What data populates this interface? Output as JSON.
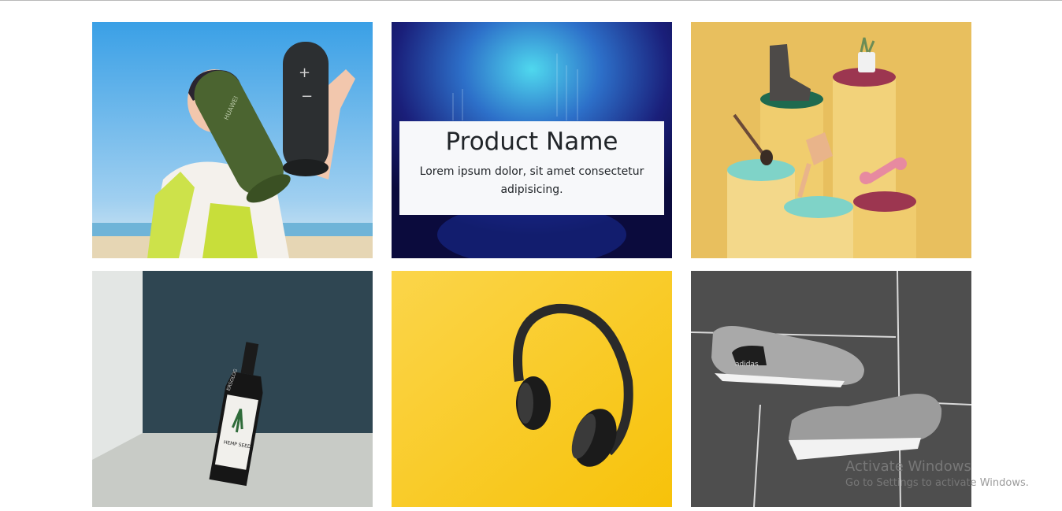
{
  "featured_card": {
    "title": "Product Name",
    "description": "Lorem ipsum dolor, sit amet consectetur adipisicing."
  },
  "speaker_brand_text": "HUAWEI",
  "bottle_label": {
    "brand": "ERSOLOG",
    "product": "HEMP SEED"
  },
  "shoe_brand_text": "adidas",
  "watermark": {
    "title": "Activate Windows",
    "subtitle": "Go to Settings to activate Windows."
  },
  "colors": {
    "accent_yellow": "#f9c60c",
    "pedestal_yellow": "#e8bf5e",
    "caption_bg": "#f7f8fa"
  }
}
